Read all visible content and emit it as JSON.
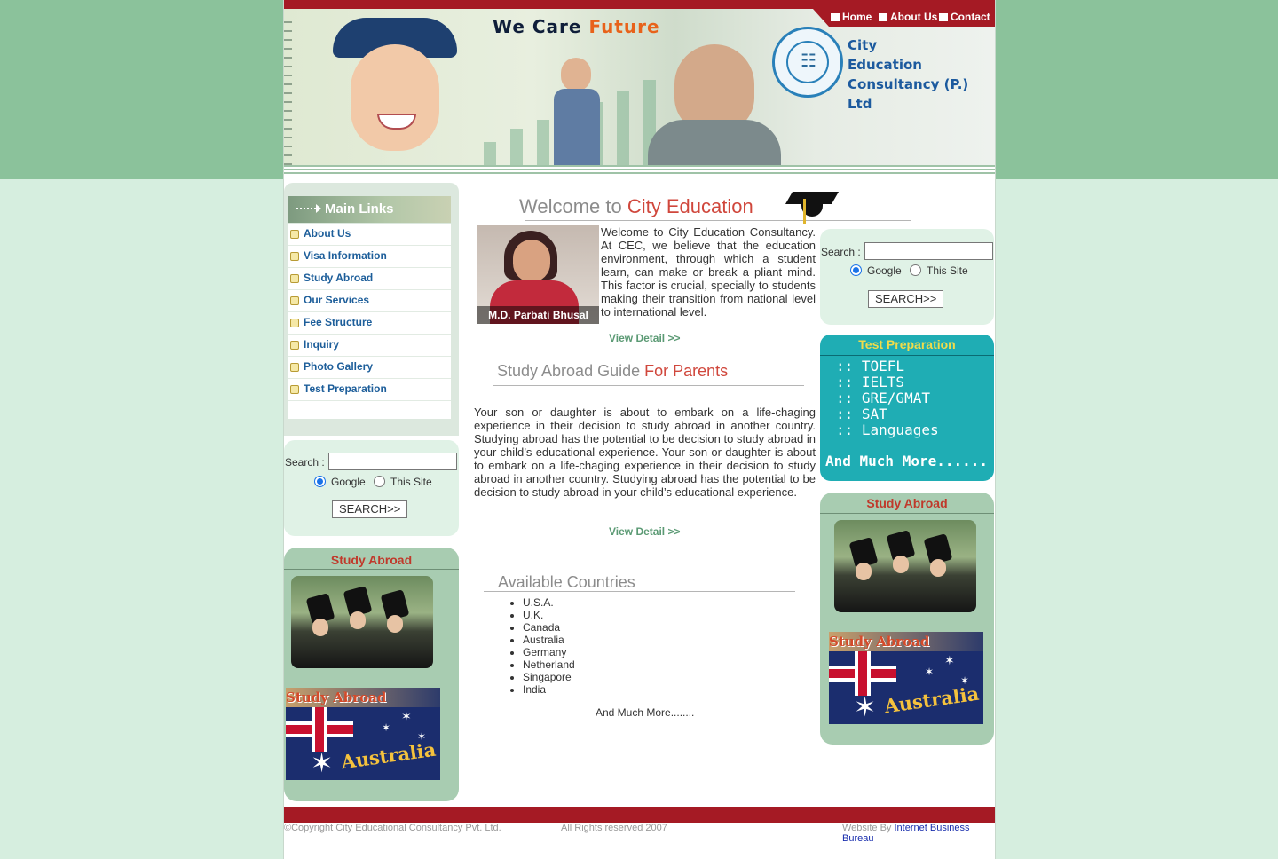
{
  "header": {
    "slogan_word1": "We Care",
    "slogan_word2": "Future",
    "nav": [
      "Home",
      "About Us",
      "Contact"
    ],
    "brand_line1": "City",
    "brand_line2": "Education",
    "brand_line3": "Consultancy (P.) Ltd"
  },
  "sidebar": {
    "title": "Main Links",
    "links": [
      "About Us",
      "Visa Information",
      "Study Abroad",
      "Our Services",
      "Fee Structure",
      "Inquiry",
      "Photo Gallery",
      "Test Preparation"
    ]
  },
  "search": {
    "label": "Search :",
    "value": "",
    "options": [
      "Google",
      "This Site"
    ],
    "selected": "Google",
    "button": "SEARCH>>"
  },
  "study_abroad": {
    "title": "Study Abroad",
    "flag_caption": "Study Abroad",
    "flag_word": "Australia"
  },
  "welcome": {
    "heading_plain": "Welcome to",
    "heading_accent": "City Education",
    "portrait_name": "M.D.  Parbati Bhusal",
    "text": "Welcome to City Education Consultancy. At CEC, we believe that the education environment, through which a student learn, can make or break a pliant mind. This factor is crucial, specially to students making their transition from national level to international level.",
    "detail": "View Detail >>"
  },
  "guide": {
    "heading_plain": "Study Abroad Guide",
    "heading_accent": "For Parents",
    "text": "Your son or daughter is about to embark on a life-chaging experience in their decision to study abroad in another country. Studying abroad has the potential to be decision to study abroad in your child’s educational experience. Your son or daughter is about to embark on a life-chaging experience in their decision to study abroad in another country. Studying abroad has the potential to be decision to study abroad in your child’s educational experience.",
    "detail": "View Detail >>"
  },
  "countries": {
    "heading": "Available Countries",
    "list": [
      "U.S.A.",
      "U.K.",
      "Canada",
      "Australia",
      "Germany",
      "Netherland",
      "Singapore",
      "India"
    ],
    "more": "And Much More........"
  },
  "test_prep": {
    "title": "Test Preparation",
    "items": [
      ":: TOEFL",
      ":: IELTS",
      ":: GRE/GMAT",
      ":: SAT",
      ":: Languages"
    ],
    "more": "And Much More......"
  },
  "footer": {
    "copyright": "©Copyright City Educational Consultancy Pvt. Ltd.",
    "rights": "All Rights reserved 2007",
    "website_by": "Website By",
    "developer": "Internet Business Bureau"
  },
  "colors": {
    "maroon": "#a51a24",
    "green_band": "#8bc29b",
    "teal": "#1fadb4",
    "link_blue": "#1d5e9a"
  }
}
